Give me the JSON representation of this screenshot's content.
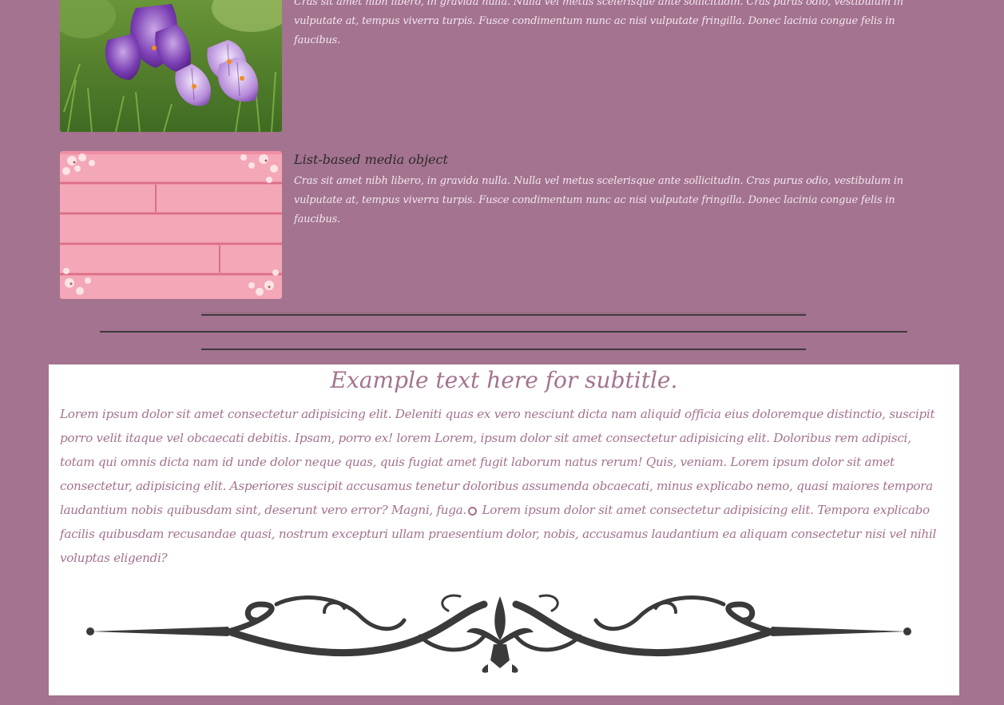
{
  "media_items": [
    {
      "heading": "",
      "text": "Cras sit amet nibh libero, in gravida nulla. Nulla vel metus scelerisque ante sollicitudin. Cras purus odio, vestibulum in vulputate at, tempus viverra turpis. Fusce condimentum nunc ac nisi vulputate fringilla. Donec lacinia congue felis in faucibus.",
      "image": "purple-crocus-flowers"
    },
    {
      "heading": "List-based media object",
      "text": "Cras sit amet nibh libero, in gravida nulla. Nulla vel metus scelerisque ante sollicitudin. Cras purus odio, vestibulum in vulputate at, tempus viverra turpis. Fusce condimentum nunc ac nisi vulputate fringilla. Donec lacinia congue felis in faucibus.",
      "image": "pink-wood-planks-with-flowers"
    }
  ],
  "card": {
    "subtitle": "Example text here for subtitle.",
    "paragraph_part1": "Lorem ipsum dolor sit amet consectetur adipisicing elit. Deleniti quas ex vero nesciunt dicta nam aliquid officia eius doloremque distinctio, suscipit porro velit itaque vel obcaecati debitis. Ipsam, porro ex! lorem Lorem, ipsum dolor sit amet consectetur adipisicing elit. Doloribus rem adipisci, totam qui omnis dicta nam id unde dolor neque quas, quis fugiat amet fugit laborum natus rerum! Quis, veniam. Lorem ipsum dolor sit amet consectetur, adipisicing elit. Asperiores suscipit accusamus tenetur doloribus assumenda obcaecati, minus explicabo nemo, quasi maiores tempora laudantium nobis quibusdam sint, deserunt vero error? Magni, fuga.",
    "paragraph_part2": " Lorem ipsum dolor sit amet consectetur adipisicing elit. Tempora explicabo facilis quibusdam recusandae quasi, nostrum excepturi ullam praesentium dolor, nobis, accusamus laudantium ea aliquam consectetur nisi vel nihil voluptas eligendi?",
    "divider": "ornamental-scroll-divider"
  },
  "colors": {
    "background": "#a3738f",
    "card": "#ffffff",
    "accent_text": "#a3738f",
    "rule": "#3f3a3d"
  }
}
